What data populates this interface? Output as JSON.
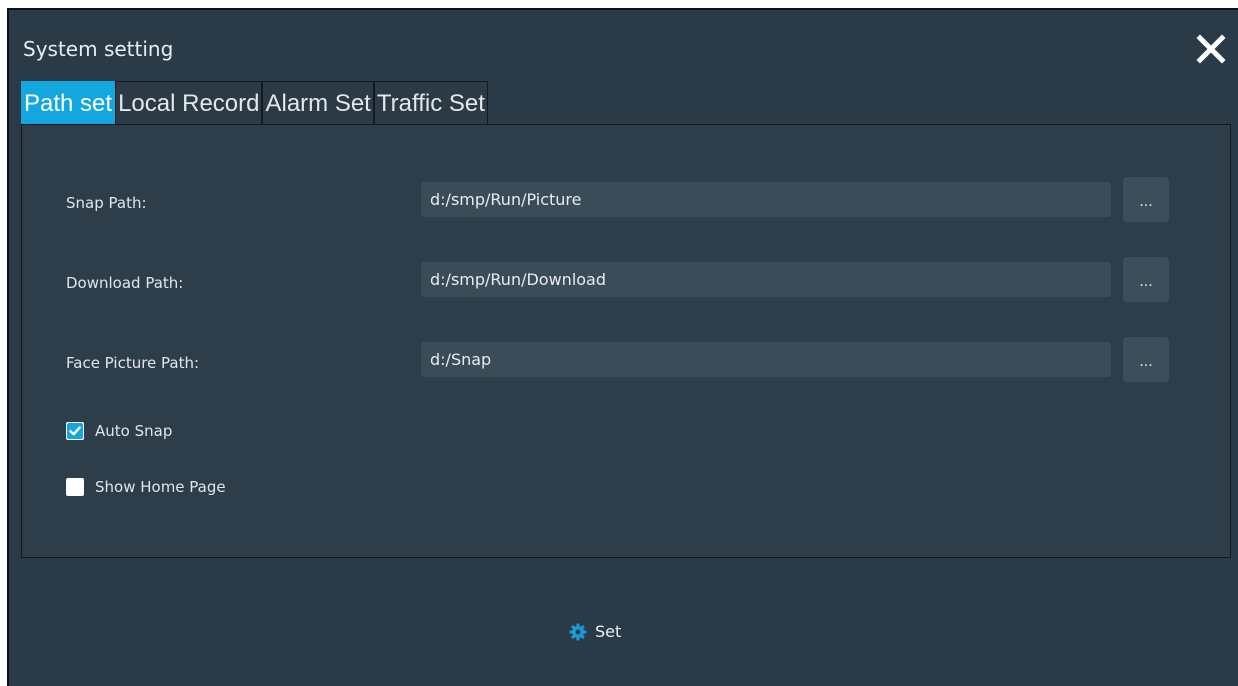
{
  "window": {
    "title": "System setting"
  },
  "tabs": [
    {
      "label": "Path set",
      "active": true
    },
    {
      "label": "Local Record",
      "active": false
    },
    {
      "label": "Alarm Set",
      "active": false
    },
    {
      "label": "Traffic Set",
      "active": false
    }
  ],
  "paths": [
    {
      "label": "Snap Path:",
      "value": "d:/smp/Run/Picture",
      "browse_label": "..."
    },
    {
      "label": "Download Path:",
      "value": "d:/smp/Run/Download",
      "browse_label": "..."
    },
    {
      "label": "Face Picture Path:",
      "value": "d:/Snap",
      "browse_label": "..."
    }
  ],
  "options": [
    {
      "label": "Auto Snap",
      "checked": true
    },
    {
      "label": "Show Home Page",
      "checked": false
    }
  ],
  "footer": {
    "set_label": "Set"
  },
  "colors": {
    "accent": "#14a6de",
    "background": "#2a3a47"
  },
  "icons": {
    "close": "close-icon",
    "set": "gear-icon",
    "checkbox": "checkmark-icon"
  }
}
